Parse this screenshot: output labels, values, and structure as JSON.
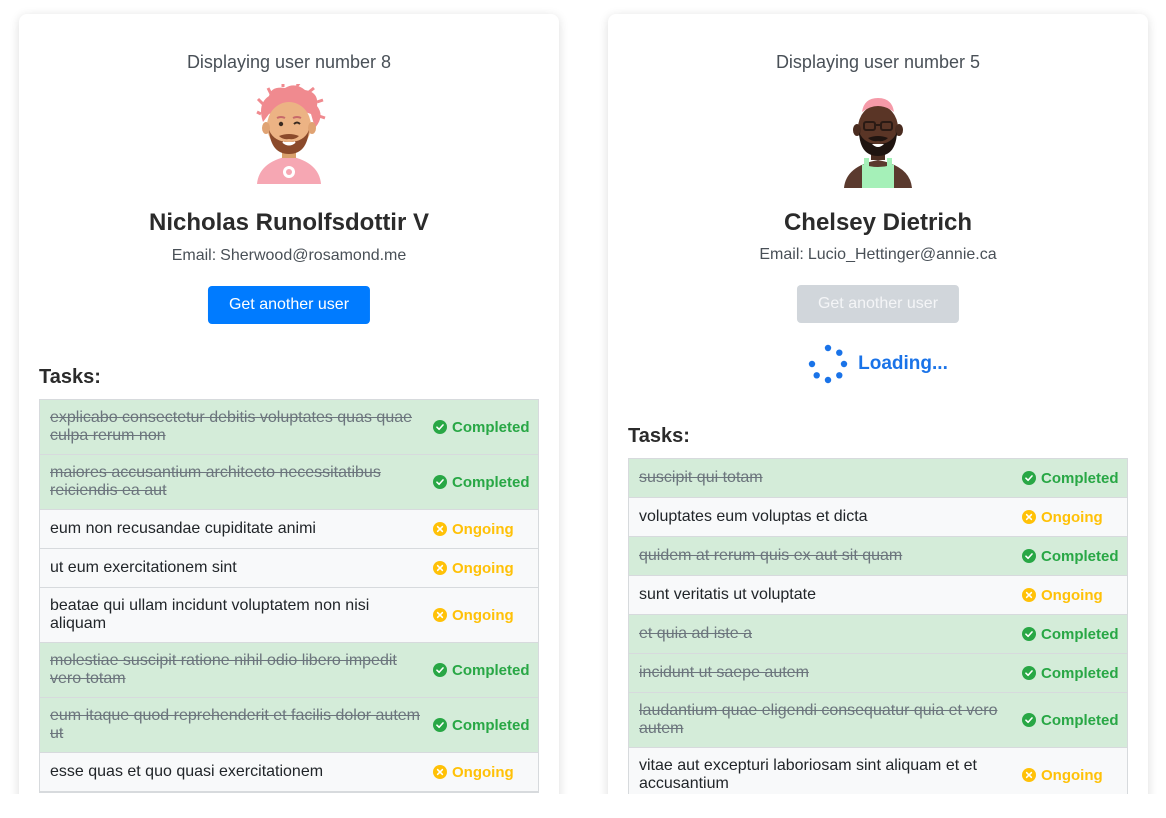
{
  "cards": [
    {
      "displaying": "Displaying user number 8",
      "avatar": "avatar-man-pink-curly-hair",
      "name": "Nicholas Runolfsdottir V",
      "email_prefix": "Email:",
      "email": "Sherwood@rosamond.me",
      "button_label": "Get another user",
      "button_state": "enabled",
      "tasks_title": "Tasks:",
      "tasks": [
        {
          "title": "explicabo consectetur debitis voluptates quas quae culpa rerum non",
          "status": "Completed"
        },
        {
          "title": "maiores accusantium architecto necessitatibus reiciendis ea aut",
          "status": "Completed"
        },
        {
          "title": "eum non recusandae cupiditate animi",
          "status": "Ongoing"
        },
        {
          "title": "ut eum exercitationem sint",
          "status": "Ongoing"
        },
        {
          "title": "beatae qui ullam incidunt voluptatem non nisi aliquam",
          "status": "Ongoing"
        },
        {
          "title": "molestiae suscipit ratione nihil odio libero impedit vero totam",
          "status": "Completed"
        },
        {
          "title": "eum itaque quod reprehenderit et facilis dolor autem ut",
          "status": "Completed"
        },
        {
          "title": "esse quas et quo quasi exercitationem",
          "status": "Ongoing"
        }
      ]
    },
    {
      "displaying": "Displaying user number 5",
      "avatar": "avatar-man-dark-skin-beard-green-overalls",
      "name": "Chelsey Dietrich",
      "email_prefix": "Email:",
      "email": "Lucio_Hettinger@annie.ca",
      "button_label": "Get another user",
      "button_state": "disabled",
      "loading_text": "Loading...",
      "tasks_title": "Tasks:",
      "tasks": [
        {
          "title": "suscipit qui totam",
          "status": "Completed"
        },
        {
          "title": "voluptates eum voluptas et dicta",
          "status": "Ongoing"
        },
        {
          "title": "quidem at rerum quis ex aut sit quam",
          "status": "Completed"
        },
        {
          "title": "sunt veritatis ut voluptate",
          "status": "Ongoing"
        },
        {
          "title": "et quia ad iste a",
          "status": "Completed"
        },
        {
          "title": "incidunt ut saepe autem",
          "status": "Completed"
        },
        {
          "title": "laudantium quae eligendi consequatur quia et vero autem",
          "status": "Completed"
        },
        {
          "title": "vitae aut excepturi laboriosam sint aliquam et et accusantium",
          "status": "Ongoing"
        }
      ]
    }
  ],
  "colors": {
    "primary": "#007bff",
    "completed_text": "#28a745",
    "completed_bg": "#d4ecd9",
    "ongoing_text": "#ffc107",
    "loading": "#1a73e8"
  },
  "icons": {
    "completed": "check-circle-icon",
    "ongoing": "x-circle-icon",
    "spinner": "spinner-icon"
  }
}
